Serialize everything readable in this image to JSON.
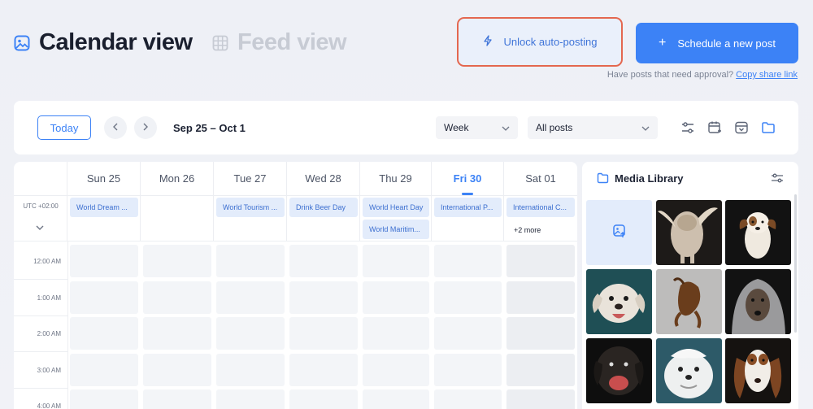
{
  "header": {
    "calendar_view": "Calendar view",
    "feed_view": "Feed view",
    "unlock_label": "Unlock auto-posting",
    "schedule_label": "Schedule a new post",
    "approval_text": "Have posts that need approval?",
    "copy_link": "Copy share link"
  },
  "toolbar": {
    "today": "Today",
    "date_range": "Sep 25 – Oct 1",
    "view_select": "Week",
    "posts_select": "All posts"
  },
  "calendar": {
    "timezone": "UTC +02:00",
    "days": [
      "Sun 25",
      "Mon 26",
      "Tue 27",
      "Wed 28",
      "Thu 29",
      "Fri 30",
      "Sat 01"
    ],
    "today_index": 5,
    "events": {
      "sun": "World Dream ...",
      "tue": "World Tourism ...",
      "wed": "Drink Beer Day",
      "thu1": "World Heart Day",
      "thu2": "World Maritim...",
      "fri": "International P...",
      "sat": "International C..."
    },
    "more": "+2 more",
    "times": [
      "12:00 AM",
      "1:00 AM",
      "2:00 AM",
      "3:00 AM",
      "4:00 AM"
    ]
  },
  "media": {
    "title": "Media Library"
  },
  "colors": {
    "accent": "#3c82f6",
    "highlight_border": "#e4674f",
    "event_bg": "#e3ecfb"
  }
}
